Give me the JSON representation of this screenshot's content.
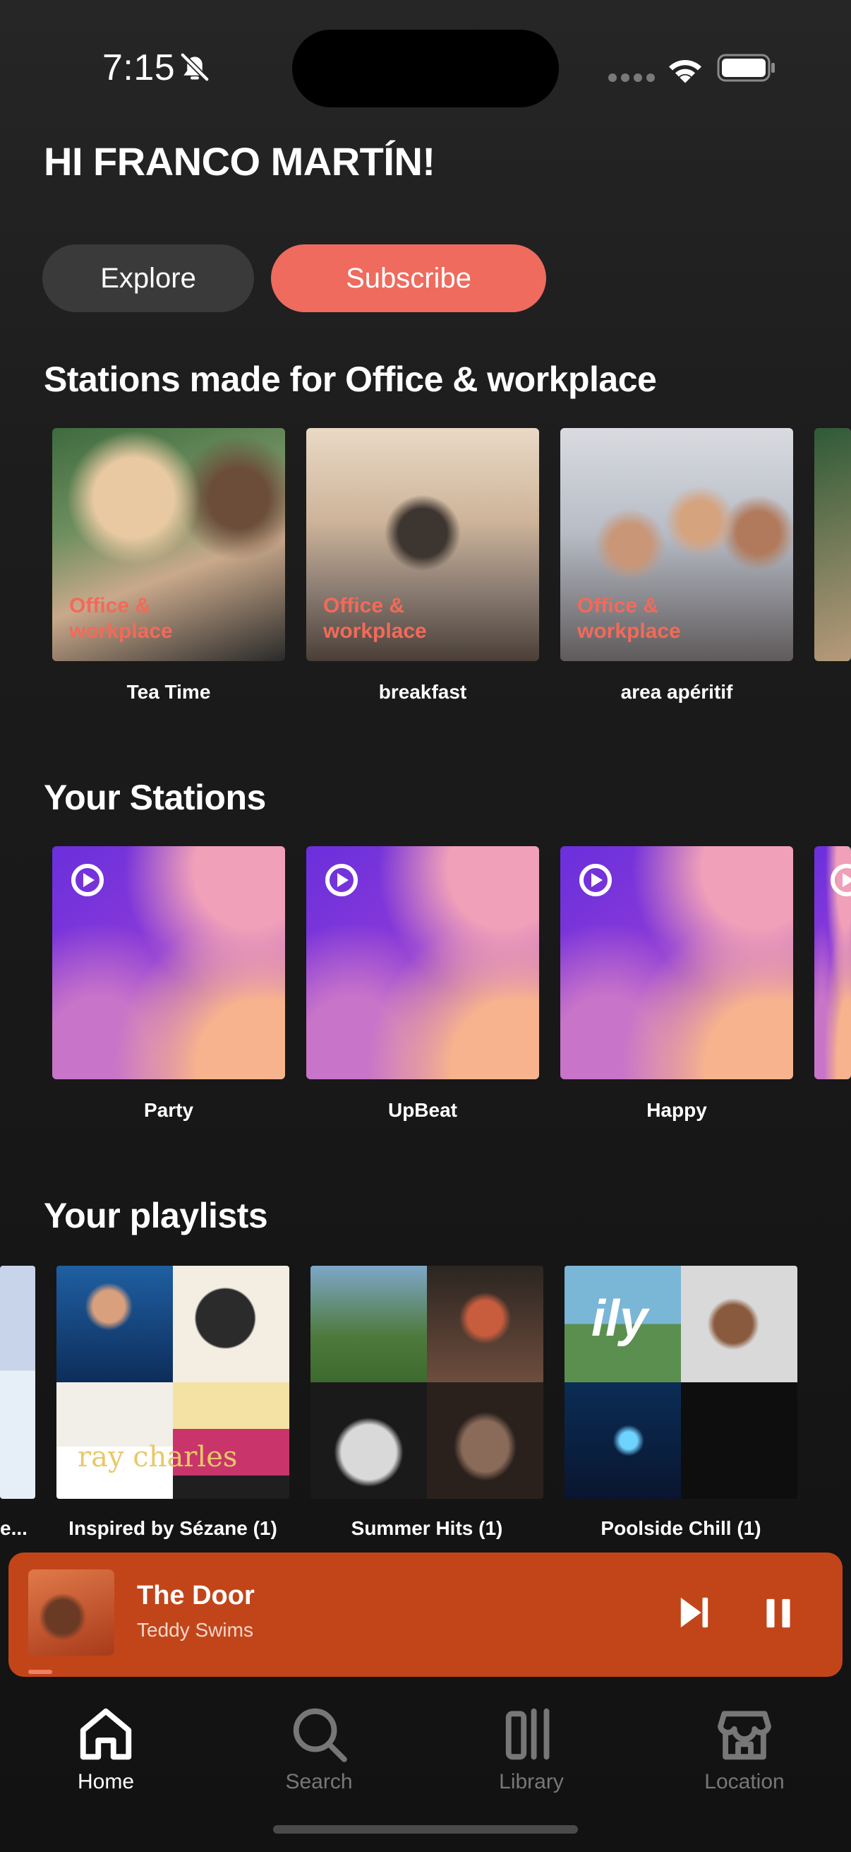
{
  "status_bar": {
    "time": "7:15"
  },
  "greeting": "HI FRANCO MARTÍN!",
  "chips": {
    "explore": "Explore",
    "subscribe": "Subscribe"
  },
  "office_section": {
    "title": "Stations made for Office & workplace",
    "overlay_line1": "Office &",
    "overlay_line2": "workplace",
    "items": [
      {
        "label": "Tea Time"
      },
      {
        "label": "breakfast"
      },
      {
        "label": "area apéritif"
      }
    ]
  },
  "your_stations": {
    "title": "Your Stations",
    "items": [
      {
        "label": "Party"
      },
      {
        "label": "UpBeat"
      },
      {
        "label": "Happy"
      }
    ]
  },
  "your_playlists": {
    "title": "Your playlists",
    "partial_label": "e...",
    "items": [
      {
        "label": "Inspired by Sézane (1)"
      },
      {
        "label": "Summer Hits (1)"
      },
      {
        "label": "Poolside Chill (1)"
      }
    ],
    "cover_text": {
      "ray_charles": "ray charles",
      "ily": "ily"
    }
  },
  "now_playing": {
    "title": "The Door",
    "artist": "Teddy Swims"
  },
  "tab_bar": {
    "home": "Home",
    "search": "Search",
    "library": "Library",
    "location": "Location"
  },
  "colors": {
    "accent": "#ee6b5e",
    "player": "#c2451a",
    "background": "#1c1c1c"
  }
}
